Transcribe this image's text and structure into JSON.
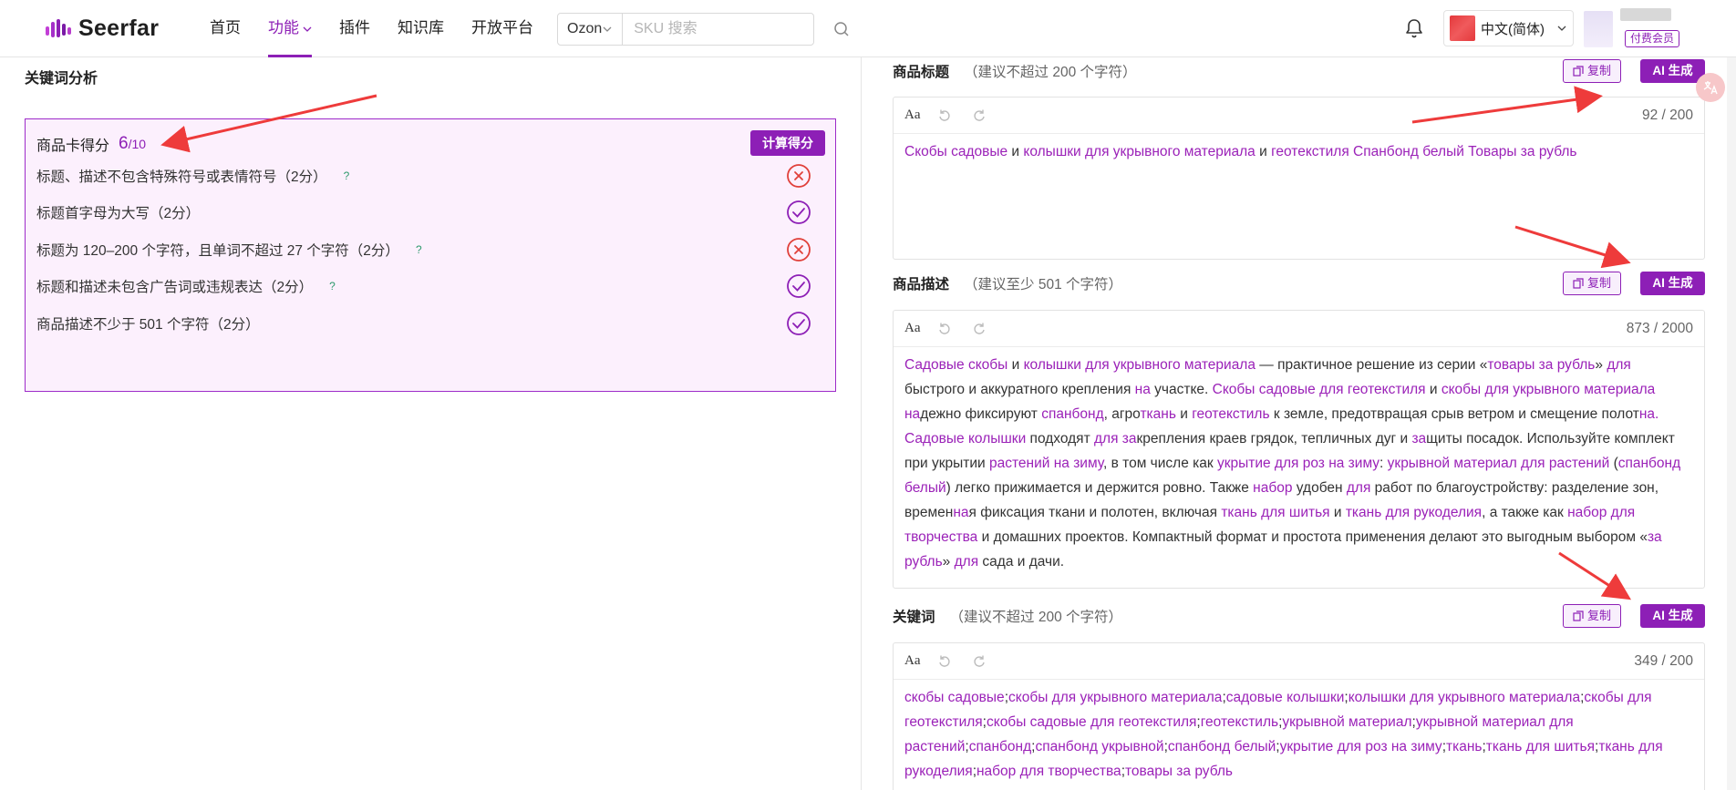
{
  "header": {
    "brand": "Seerfar",
    "nav": [
      {
        "label": "首页",
        "active": false
      },
      {
        "label": "功能",
        "active": true,
        "dropdown": true
      },
      {
        "label": "插件",
        "active": false
      },
      {
        "label": "知识库",
        "active": false
      },
      {
        "label": "开放平台",
        "active": false
      }
    ],
    "search": {
      "platform": "Ozon",
      "placeholder": "SKU 搜索"
    },
    "language": "中文(简体)",
    "member_badge": "付费会员"
  },
  "left": {
    "section_title": "关键词分析",
    "score": {
      "label": "商品卡得分",
      "value": "6",
      "max": "/10",
      "calc_button": "计算得分"
    },
    "rules": [
      {
        "text": "标题、描述不包含特殊符号或表情符号（2分）",
        "help": "?",
        "status": "fail"
      },
      {
        "text": "标题首字母为大写（2分）",
        "help": "",
        "status": "pass"
      },
      {
        "text": "标题为 120–200 个字符，且单词不超过 27 个字符（2分）",
        "help": "?",
        "status": "fail"
      },
      {
        "text": "标题和描述未包含广告词或违规表达（2分）",
        "help": "?",
        "status": "pass"
      },
      {
        "text": "商品描述不少于 501 个字符（2分）",
        "help": "",
        "status": "pass"
      }
    ]
  },
  "right": {
    "copy_label": "复制",
    "ai_label": "AI 生成",
    "toolbar_aa": "Aa",
    "title_field": {
      "label": "商品标题",
      "hint": "（建议不超过 200 个字符）",
      "count": "92 / 200",
      "segments": [
        {
          "t": "Скобы садовые",
          "k": true
        },
        {
          "t": " и ",
          "k": false
        },
        {
          "t": "колышки для укрывного материала",
          "k": true
        },
        {
          "t": " и ",
          "k": false
        },
        {
          "t": "геотекстиля Спанбонд белый Товары за рубль",
          "k": true
        }
      ]
    },
    "desc_field": {
      "label": "商品描述",
      "hint": "（建议至少 501 个字符）",
      "count": "873 / 2000",
      "segments": [
        {
          "t": "Садовые скобы",
          "k": true
        },
        {
          "t": " и ",
          "k": false
        },
        {
          "t": "колышки для укрывного материала",
          "k": true
        },
        {
          "t": " — практичное решение из серии «",
          "k": false
        },
        {
          "t": "товары за рубль",
          "k": true
        },
        {
          "t": "» ",
          "k": false
        },
        {
          "t": "для",
          "k": true
        },
        {
          "t": " быстрого и аккуратного крепления ",
          "k": false
        },
        {
          "t": "на",
          "k": true
        },
        {
          "t": " участке. ",
          "k": false
        },
        {
          "t": "Скобы садовые для геотекстиля",
          "k": true
        },
        {
          "t": " и ",
          "k": false
        },
        {
          "t": "скобы для укрывного материала на",
          "k": true
        },
        {
          "t": "дежно фиксируют ",
          "k": false
        },
        {
          "t": "спанбонд",
          "k": true
        },
        {
          "t": ", агро",
          "k": false
        },
        {
          "t": "ткань",
          "k": true
        },
        {
          "t": " и ",
          "k": false
        },
        {
          "t": "геотекстиль",
          "k": true
        },
        {
          "t": " к земле, предотвращая срыв ветром и смещение полот",
          "k": false
        },
        {
          "t": "на. Садовые колышки",
          "k": true
        },
        {
          "t": " подходят ",
          "k": false
        },
        {
          "t": "для за",
          "k": true
        },
        {
          "t": "крепления краев грядок, тепличных дуг и ",
          "k": false
        },
        {
          "t": "за",
          "k": true
        },
        {
          "t": "щиты посадок. Используйте комплект при укрытии ",
          "k": false
        },
        {
          "t": "растений на зиму",
          "k": true
        },
        {
          "t": ", в том числе как ",
          "k": false
        },
        {
          "t": "укрытие для роз на зиму",
          "k": true
        },
        {
          "t": ": ",
          "k": false
        },
        {
          "t": "укрывной материал для растений",
          "k": true
        },
        {
          "t": " (",
          "k": false
        },
        {
          "t": "спанбонд белый",
          "k": true
        },
        {
          "t": ") легко прижимается и держится ровно. Также ",
          "k": false
        },
        {
          "t": "набор",
          "k": true
        },
        {
          "t": " удобен ",
          "k": false
        },
        {
          "t": "для",
          "k": true
        },
        {
          "t": " работ по благоустройству: разделение зон, времен",
          "k": false
        },
        {
          "t": "на",
          "k": true
        },
        {
          "t": "я фиксация ткани и полотен, включая ",
          "k": false
        },
        {
          "t": "ткань для шитья",
          "k": true
        },
        {
          "t": " и ",
          "k": false
        },
        {
          "t": "ткань для рукоделия",
          "k": true
        },
        {
          "t": ", а также как ",
          "k": false
        },
        {
          "t": "набор для творчества",
          "k": true
        },
        {
          "t": " и домашних проектов. Компактный формат и простота применения делают это выгодным выбором «",
          "k": false
        },
        {
          "t": "за рубль",
          "k": true
        },
        {
          "t": "» ",
          "k": false
        },
        {
          "t": "для",
          "k": true
        },
        {
          "t": " сада и дачи.",
          "k": false
        }
      ]
    },
    "kw_field": {
      "label": "关键词",
      "hint": "（建议不超过 200 个字符）",
      "count": "349 / 200",
      "segments": [
        {
          "t": "скобы садовые",
          "k": true
        },
        {
          "t": ";",
          "k": false
        },
        {
          "t": "скобы для укрывного материала",
          "k": true
        },
        {
          "t": ";",
          "k": false
        },
        {
          "t": "садовые колышки",
          "k": true
        },
        {
          "t": ";",
          "k": false
        },
        {
          "t": "колышки для укрывного материала",
          "k": true
        },
        {
          "t": ";",
          "k": false
        },
        {
          "t": "скобы для геотекстиля",
          "k": true
        },
        {
          "t": ";",
          "k": false
        },
        {
          "t": "скобы садовые для геотекстиля",
          "k": true
        },
        {
          "t": ";",
          "k": false
        },
        {
          "t": "геотекстиль",
          "k": true
        },
        {
          "t": ";",
          "k": false
        },
        {
          "t": "укрывной материал",
          "k": true
        },
        {
          "t": ";",
          "k": false
        },
        {
          "t": "укрывной материал для растений",
          "k": true
        },
        {
          "t": ";",
          "k": false
        },
        {
          "t": "спанбонд",
          "k": true
        },
        {
          "t": ";",
          "k": false
        },
        {
          "t": "спанбонд укрывной",
          "k": true
        },
        {
          "t": ";",
          "k": false
        },
        {
          "t": "спанбонд белый",
          "k": true
        },
        {
          "t": ";",
          "k": false
        },
        {
          "t": "укрытие для роз на зиму",
          "k": true
        },
        {
          "t": ";",
          "k": false
        },
        {
          "t": "ткань",
          "k": true
        },
        {
          "t": ";",
          "k": false
        },
        {
          "t": "ткань для шитья",
          "k": true
        },
        {
          "t": ";",
          "k": false
        },
        {
          "t": "ткань для рукоделия",
          "k": true
        },
        {
          "t": ";",
          "k": false
        },
        {
          "t": "набор для творчества",
          "k": true
        },
        {
          "t": ";",
          "k": false
        },
        {
          "t": "товары за рубль",
          "k": true
        }
      ]
    }
  },
  "colors": {
    "accent": "#8d1fb6",
    "keyword": "#9b22b8",
    "fail": "#e0403a",
    "arrow": "#ee3b3b"
  }
}
